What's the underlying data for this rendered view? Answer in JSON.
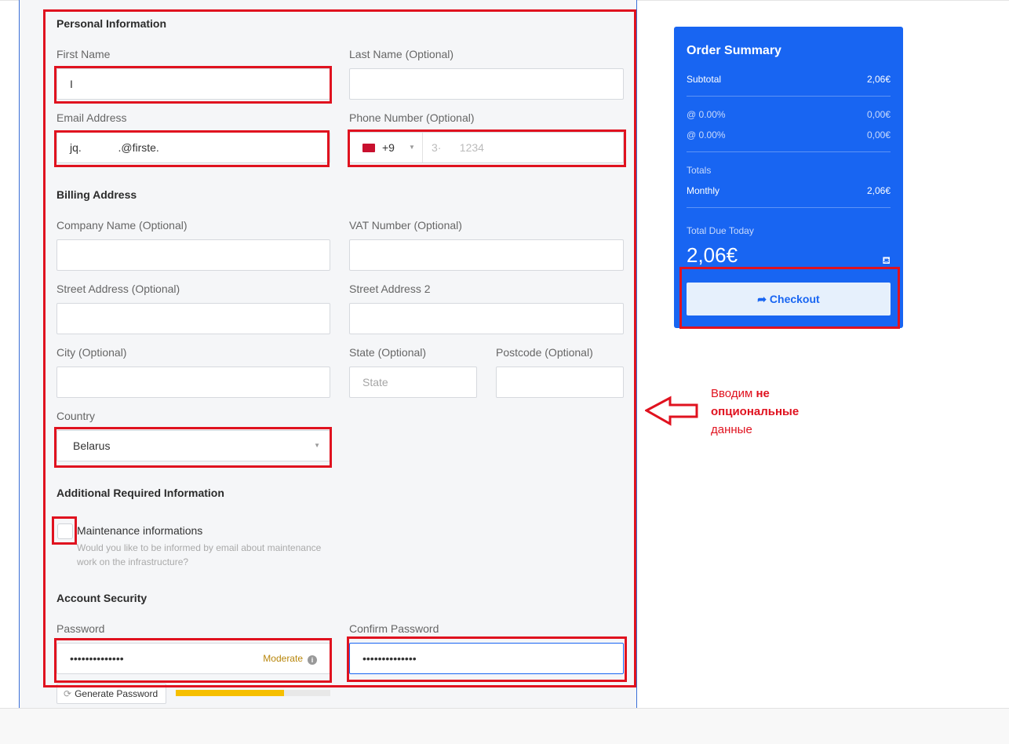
{
  "personal": {
    "heading": "Personal Information",
    "first_name_label": "First Name",
    "first_name_value": "I",
    "last_name_label": "Last Name (Optional)",
    "email_label": "Email Address",
    "email_value": "jq.            .@firste.",
    "phone_label": "Phone Number (Optional)",
    "phone_code": "+9",
    "phone_placeholder": "3·      1234"
  },
  "billing": {
    "heading": "Billing Address",
    "company_label": "Company Name (Optional)",
    "vat_label": "VAT Number (Optional)",
    "street_label": "Street Address (Optional)",
    "street2_label": "Street Address 2",
    "city_label": "City (Optional)",
    "state_label": "State (Optional)",
    "state_placeholder": "State",
    "postcode_label": "Postcode (Optional)",
    "country_label": "Country",
    "country_value": "Belarus"
  },
  "additional": {
    "heading": "Additional Required Information",
    "checkbox_title": "Maintenance informations",
    "checkbox_desc": "Would you like to be informed by email about maintenance work on the infrastructure?"
  },
  "security": {
    "heading": "Account Security",
    "password_label": "Password",
    "password_value": "••••••••••••••",
    "strength_label": "Moderate",
    "confirm_label": "Confirm Password",
    "confirm_value": "••••••••••••••",
    "generate_label": "Generate Password",
    "strength_fraction": 0.7
  },
  "summary": {
    "title": "Order Summary",
    "subtotal_label": "Subtotal",
    "subtotal_value": "2,06€",
    "tax1_label": "@ 0.00%",
    "tax1_value": "0,00€",
    "tax2_label": "@ 0.00%",
    "tax2_value": "0,00€",
    "totals_label": "Totals",
    "monthly_label": "Monthly",
    "monthly_value": "2,06€",
    "due_label": "Total Due Today",
    "due_value": "2,06€",
    "checkout_label": "Checkout"
  },
  "annotation": {
    "line1_normal": "Вводим ",
    "line1_bold": "не",
    "line2_bold": "опциональные",
    "line3": "данные"
  },
  "colors": {
    "highlight": "#e0121f",
    "summary_bg": "#1865f2",
    "strength_bar": "#f6bf00"
  },
  "icons": {
    "phone_flag": "flag-icon",
    "dropdown": "caret-down-icon",
    "info": "info-icon",
    "generate": "refresh-icon",
    "checkout": "share-arrow-icon",
    "cart": "cart-icon",
    "annotation_arrow": "left-arrow-icon"
  }
}
